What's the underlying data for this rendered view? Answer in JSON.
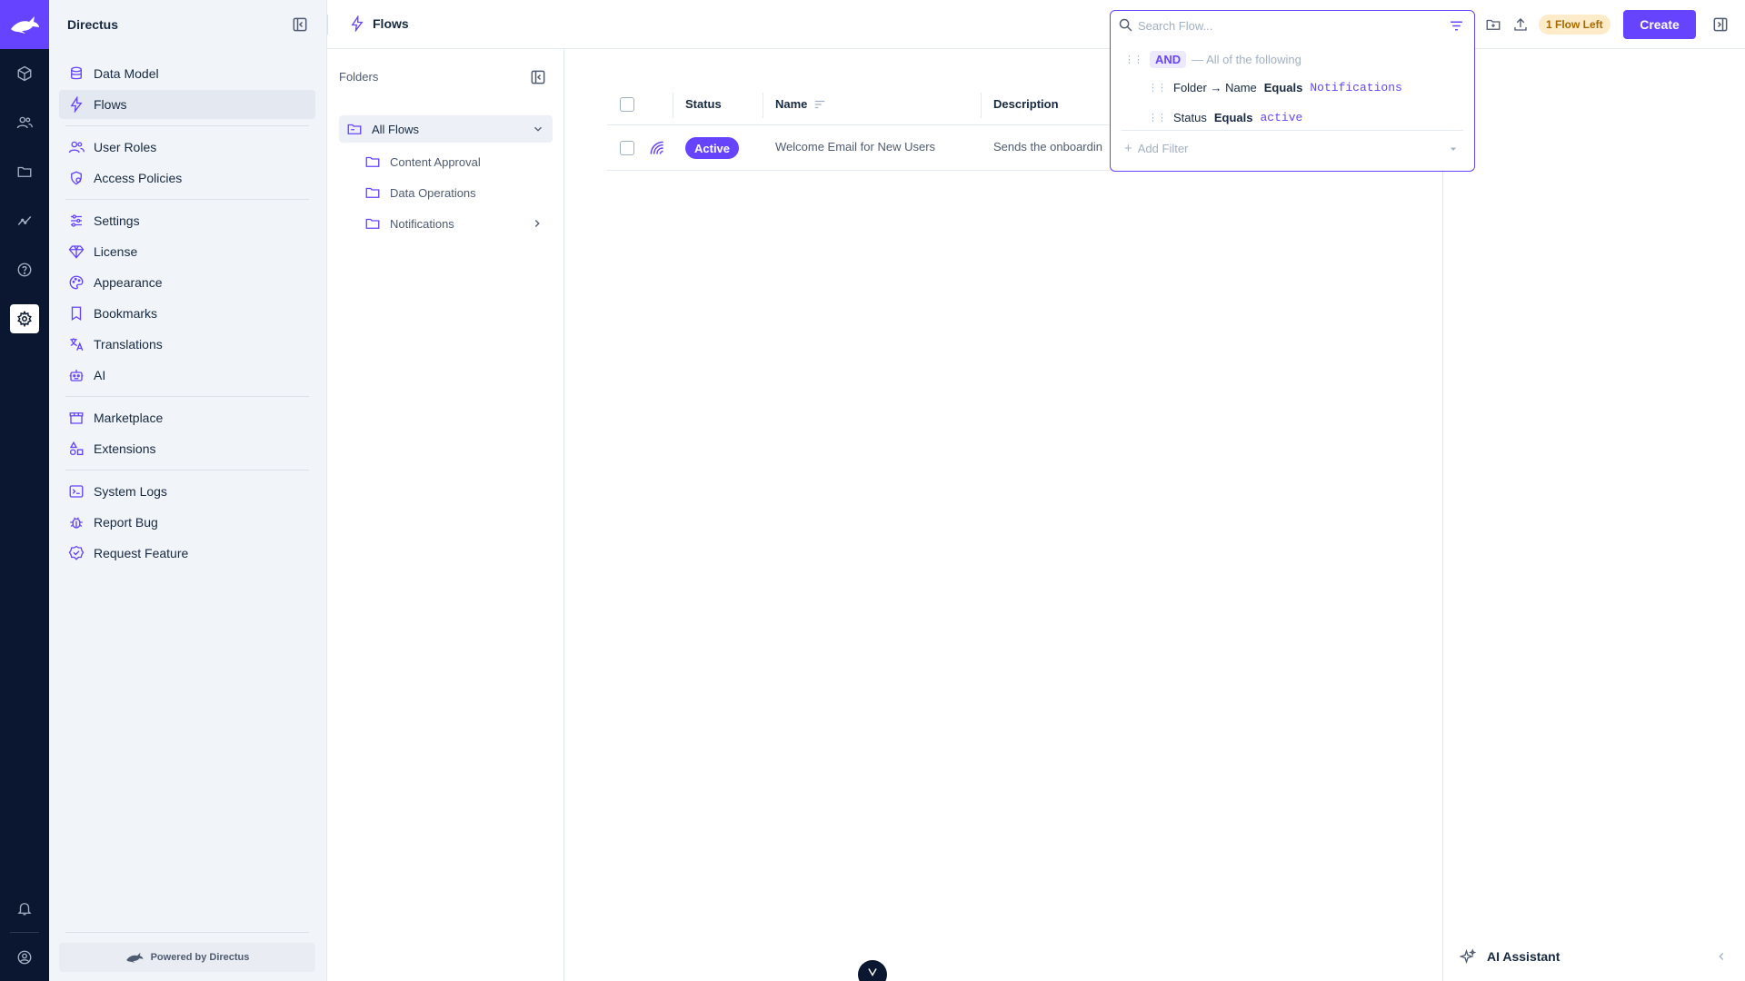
{
  "app": {
    "name": "Directus"
  },
  "colors": {
    "accent": "#6644ff",
    "dark": "#0b1730",
    "warning_bg": "#fdebc9",
    "warning_text": "#a86a00"
  },
  "module_bar": {
    "icons": [
      "directus-rabbit-logo-icon",
      "box-icon",
      "users-icon",
      "folder-icon",
      "insights-icon",
      "help-icon",
      "settings-icon",
      "bell-icon",
      "account-icon"
    ]
  },
  "nav": {
    "title": "Directus",
    "items": [
      {
        "label": "Data Model",
        "icon": "database-icon"
      },
      {
        "label": "Flows",
        "icon": "bolt-icon",
        "active": true
      },
      {
        "label": "User Roles",
        "icon": "users-icon"
      },
      {
        "label": "Access Policies",
        "icon": "policy-icon"
      },
      {
        "label": "Settings",
        "icon": "sliders-icon"
      },
      {
        "label": "License",
        "icon": "diamond-icon"
      },
      {
        "label": "Appearance",
        "icon": "palette-icon"
      },
      {
        "label": "Bookmarks",
        "icon": "bookmark-icon"
      },
      {
        "label": "Translations",
        "icon": "translate-icon"
      },
      {
        "label": "AI",
        "icon": "robot-icon"
      },
      {
        "label": "Marketplace",
        "icon": "store-icon"
      },
      {
        "label": "Extensions",
        "icon": "extensions-icon"
      },
      {
        "label": "System Logs",
        "icon": "terminal-icon"
      },
      {
        "label": "Report Bug",
        "icon": "bug-icon"
      },
      {
        "label": "Request Feature",
        "icon": "verified-icon"
      }
    ],
    "powered_by": "Powered by Directus"
  },
  "header": {
    "title": "Flows",
    "search_placeholder": "Search Flow...",
    "flows_left": "1 Flow Left",
    "create_label": "Create"
  },
  "filter": {
    "group_operator": "AND",
    "group_text": "— All of the following",
    "rules": [
      {
        "field": "Folder → Name",
        "operator": "Equals",
        "value": "Notifications"
      },
      {
        "field": "Status",
        "operator": "Equals",
        "value": "active"
      }
    ],
    "add_filter": "Add Filter"
  },
  "folders": {
    "title": "Folders",
    "all_label": "All Flows",
    "items": [
      "Content Approval",
      "Data Operations",
      "Notifications"
    ]
  },
  "table": {
    "columns": [
      "Status",
      "Name",
      "Description"
    ],
    "rows": [
      {
        "status": "Active",
        "name": "Welcome Email for New Users",
        "description": "Sends the onboardin"
      }
    ]
  },
  "sidebar_right": {
    "ai_label": "AI Assistant"
  }
}
